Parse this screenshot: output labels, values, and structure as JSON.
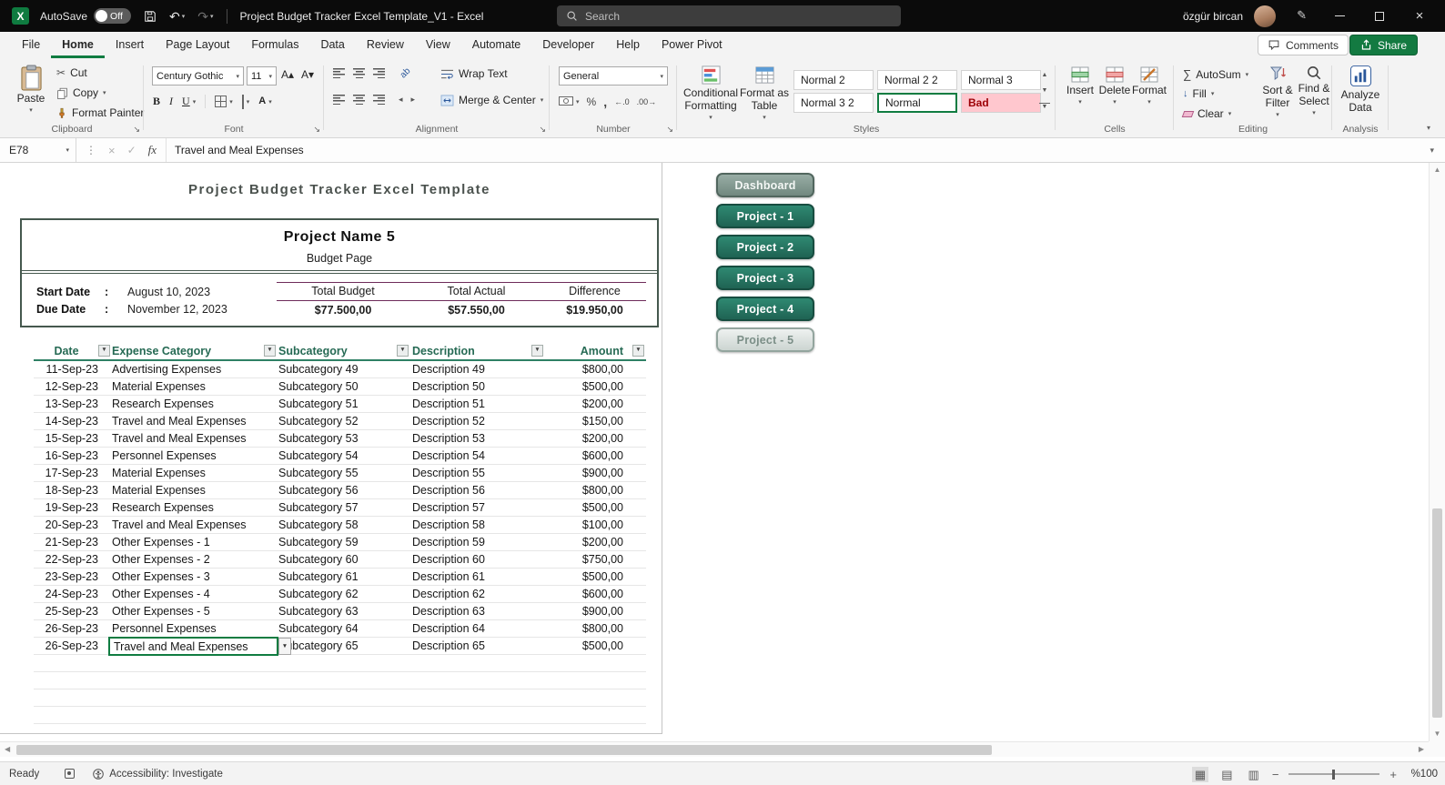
{
  "icons": {
    "excel_logo": "X",
    "undo": "↶",
    "redo": "↷",
    "dropdown": "▾",
    "filter": "▼",
    "launcher": "↘",
    "cut_glyph": "✂",
    "bold": "B",
    "italic": "I",
    "underline": "U",
    "autosum_sigma": "∑",
    "percent": "%",
    "comma": ",",
    "decimal_increase": "←.0",
    "decimal_decrease": ".00→",
    "fill_arrow": "↓",
    "cancel": "×",
    "enter": "✓",
    "fx": "fx",
    "kebab": "⋮",
    "close": "×",
    "pen": "✎",
    "font_grow": "A▴",
    "font_shrink": "A▾",
    "orientation": "ab",
    "indent_left": "◂",
    "indent_right": "▸",
    "font_color_letter": "A",
    "up": "▲",
    "down": "▼",
    "left": "◀",
    "right": "▶",
    "view_normal": "▦",
    "view_layout": "▤",
    "view_break": "▥",
    "zoom_out": "−",
    "zoom_in": "+"
  },
  "titlebar": {
    "autosave_label": "AutoSave",
    "autosave_state": "Off",
    "title": "Project Budget Tracker Excel Template_V1 - Excel",
    "search_placeholder": "Search",
    "user_name": "özgür bircan"
  },
  "ribbon": {
    "tabs": [
      {
        "label": "File",
        "class": ""
      },
      {
        "label": "Home",
        "class": "active"
      },
      {
        "label": "Insert",
        "class": ""
      },
      {
        "label": "Page Layout",
        "class": ""
      },
      {
        "label": "Formulas",
        "class": ""
      },
      {
        "label": "Data",
        "class": ""
      },
      {
        "label": "Review",
        "class": ""
      },
      {
        "label": "View",
        "class": ""
      },
      {
        "label": "Automate",
        "class": ""
      },
      {
        "label": "Developer",
        "class": ""
      },
      {
        "label": "Help",
        "class": ""
      },
      {
        "label": "Power Pivot",
        "class": ""
      }
    ],
    "comments_label": "Comments",
    "share_label": "Share",
    "clipboard": {
      "group_label": "Clipboard",
      "paste": "Paste",
      "cut": "Cut",
      "copy": "Copy",
      "format_painter": "Format Painter"
    },
    "font": {
      "group_label": "Font",
      "font_name": "Century Gothic",
      "font_size": "11"
    },
    "alignment": {
      "group_label": "Alignment",
      "wrap_text": "Wrap Text",
      "merge_center": "Merge & Center"
    },
    "number": {
      "group_label": "Number",
      "format": "General"
    },
    "styles": {
      "group_label": "Styles",
      "conditional_formatting": "Conditional Formatting",
      "format_as_table": "Format as Table",
      "gallery": [
        {
          "label": "Normal 2",
          "class": ""
        },
        {
          "label": "Normal 2 2",
          "class": ""
        },
        {
          "label": "Normal 3",
          "class": ""
        },
        {
          "label": "Normal 3 2",
          "class": ""
        },
        {
          "label": "Normal",
          "class": "style-selected"
        },
        {
          "label": "Bad",
          "class": "style-bad"
        }
      ]
    },
    "cells": {
      "group_label": "Cells",
      "insert": "Insert",
      "delete": "Delete",
      "format": "Format"
    },
    "editing": {
      "group_label": "Editing",
      "autosum": "AutoSum",
      "fill": "Fill",
      "clear": "Clear",
      "sort_filter": "Sort & Filter",
      "find_select": "Find & Select"
    },
    "analysis": {
      "group_label": "Analysis",
      "analyze_data": "Analyze Data"
    }
  },
  "formula_bar": {
    "cell_ref": "E78",
    "formula": "Travel and Meal Expenses"
  },
  "sheet": {
    "page_title": "Project Budget Tracker Excel Template",
    "project_name": "Project Name 5",
    "page_subtitle": "Budget Page",
    "start_date_label": "Start Date",
    "due_date_label": "Due Date",
    "colon": ":",
    "start_date": "August 10, 2023",
    "due_date": "November 12, 2023",
    "totals": {
      "headers": [
        "Total Budget",
        "Total Actual",
        "Difference"
      ],
      "values": [
        "$77.500,00",
        "$57.550,00",
        "$19.950,00"
      ]
    },
    "table": {
      "columns": [
        "Date",
        "Expense Category",
        "Subcategory",
        "Description",
        "Amount"
      ],
      "rows": [
        {
          "date": "11-Sep-23",
          "category": "Advertising Expenses",
          "subcategory": "Subcategory 49",
          "description": "Description 49",
          "amount": "$800,00"
        },
        {
          "date": "12-Sep-23",
          "category": "Material Expenses",
          "subcategory": "Subcategory 50",
          "description": "Description 50",
          "amount": "$500,00"
        },
        {
          "date": "13-Sep-23",
          "category": "Research Expenses",
          "subcategory": "Subcategory 51",
          "description": "Description 51",
          "amount": "$200,00"
        },
        {
          "date": "14-Sep-23",
          "category": "Travel and Meal Expenses",
          "subcategory": "Subcategory 52",
          "description": "Description 52",
          "amount": "$150,00"
        },
        {
          "date": "15-Sep-23",
          "category": "Travel and Meal Expenses",
          "subcategory": "Subcategory 53",
          "description": "Description 53",
          "amount": "$200,00"
        },
        {
          "date": "16-Sep-23",
          "category": "Personnel Expenses",
          "subcategory": "Subcategory 54",
          "description": "Description 54",
          "amount": "$600,00"
        },
        {
          "date": "17-Sep-23",
          "category": "Material Expenses",
          "subcategory": "Subcategory 55",
          "description": "Description 55",
          "amount": "$900,00"
        },
        {
          "date": "18-Sep-23",
          "category": "Material Expenses",
          "subcategory": "Subcategory 56",
          "description": "Description 56",
          "amount": "$800,00"
        },
        {
          "date": "19-Sep-23",
          "category": "Research Expenses",
          "subcategory": "Subcategory 57",
          "description": "Description 57",
          "amount": "$500,00"
        },
        {
          "date": "20-Sep-23",
          "category": "Travel and Meal Expenses",
          "subcategory": "Subcategory 58",
          "description": "Description 58",
          "amount": "$100,00"
        },
        {
          "date": "21-Sep-23",
          "category": "Other Expenses - 1",
          "subcategory": "Subcategory 59",
          "description": "Description 59",
          "amount": "$200,00"
        },
        {
          "date": "22-Sep-23",
          "category": "Other Expenses - 2",
          "subcategory": "Subcategory 60",
          "description": "Description 60",
          "amount": "$750,00"
        },
        {
          "date": "23-Sep-23",
          "category": "Other Expenses - 3",
          "subcategory": "Subcategory 61",
          "description": "Description 61",
          "amount": "$500,00"
        },
        {
          "date": "24-Sep-23",
          "category": "Other Expenses - 4",
          "subcategory": "Subcategory 62",
          "description": "Description 62",
          "amount": "$600,00"
        },
        {
          "date": "25-Sep-23",
          "category": "Other Expenses - 5",
          "subcategory": "Subcategory 63",
          "description": "Description 63",
          "amount": "$900,00"
        },
        {
          "date": "26-Sep-23",
          "category": "Personnel Expenses",
          "subcategory": "Subcategory 64",
          "description": "Description 64",
          "amount": "$800,00"
        }
      ],
      "selected_row": {
        "date": "26-Sep-23",
        "category": "Travel and Meal Expenses",
        "subcategory": "Subcategory 65",
        "description": "Description 65",
        "amount": "$500,00"
      }
    },
    "nav_buttons": [
      {
        "label": "Dashboard",
        "class": "nav-dashboard"
      },
      {
        "label": "Project - 1",
        "class": "nav-green"
      },
      {
        "label": "Project - 2",
        "class": "nav-green"
      },
      {
        "label": "Project - 3",
        "class": "nav-green"
      },
      {
        "label": "Project - 4",
        "class": "nav-green"
      },
      {
        "label": "Project - 5",
        "class": "nav-active"
      }
    ]
  },
  "status_bar": {
    "ready": "Ready",
    "accessibility": "Accessibility: Investigate",
    "zoom": "%100"
  },
  "colors": {
    "accent_green": "#107c41",
    "selection_green": "#107c41",
    "table_header_green": "#266a54",
    "purple_rule": "#6e2c5a",
    "bad_style_bg": "#ffc7ce",
    "bad_style_text": "#9c0006",
    "nav_button_green": "#2f8972"
  }
}
